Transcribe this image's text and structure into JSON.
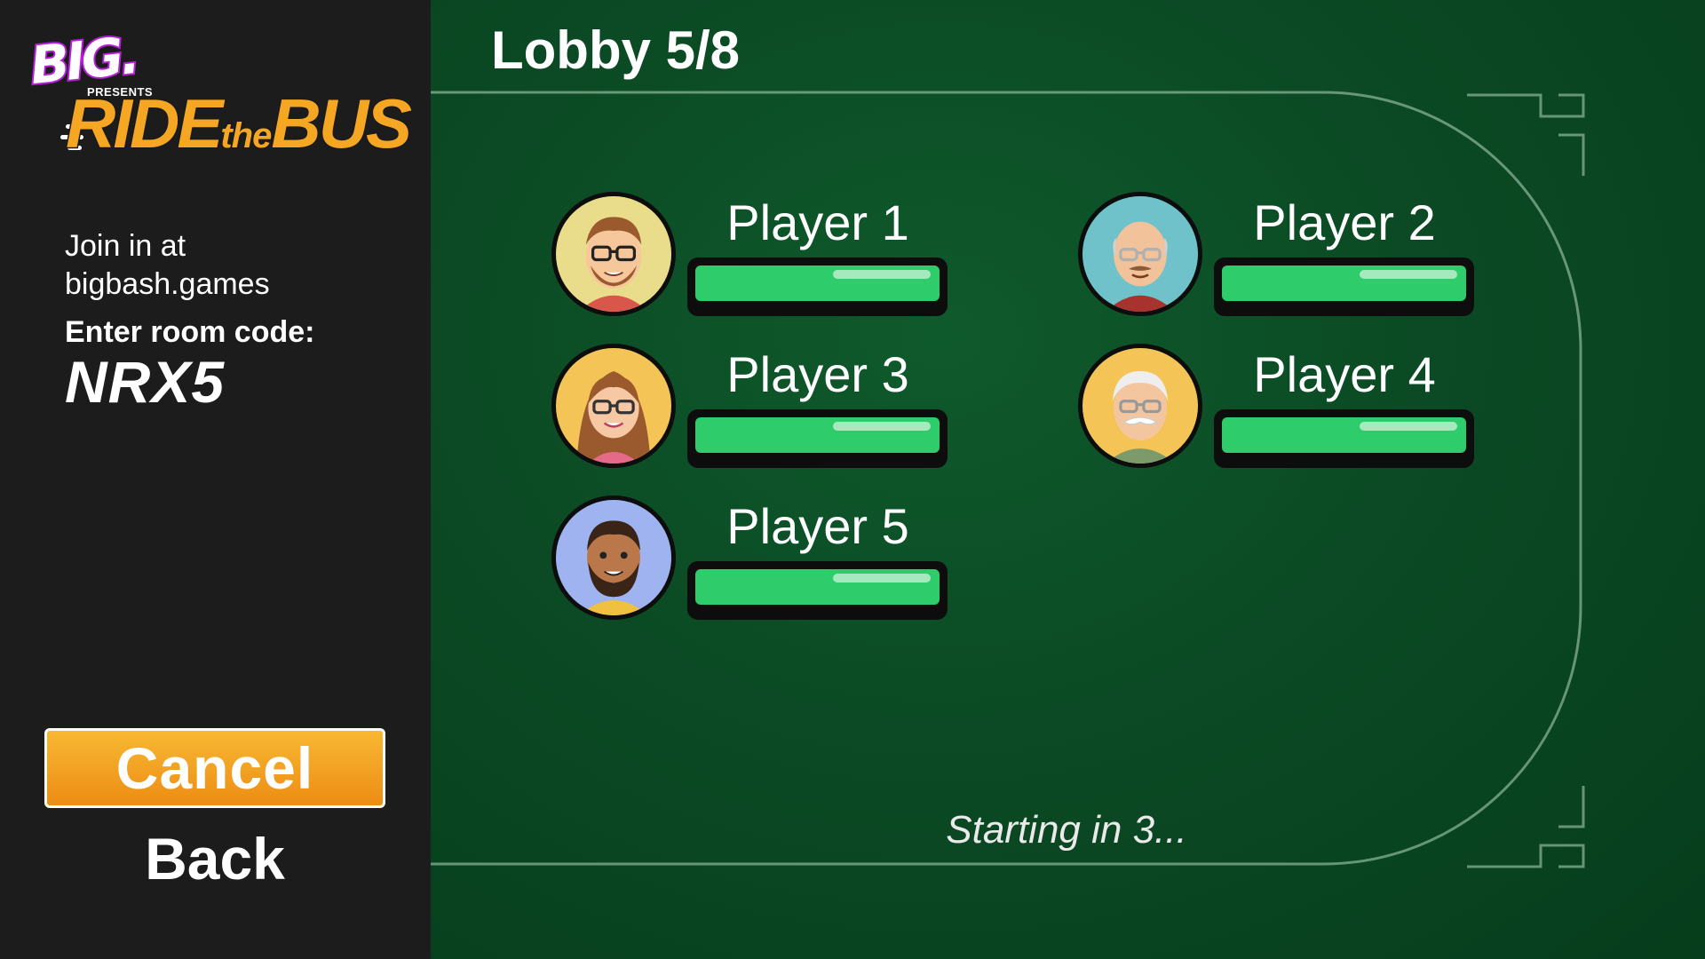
{
  "sidebar": {
    "logo": {
      "big": "BIG.",
      "presents": "PRESENTS",
      "title_ride": "RIDE",
      "title_the": "the",
      "title_bus": "BUS"
    },
    "join_line1": "Join in at",
    "join_line2": "bigbash.games",
    "room_code_label": "Enter room code:",
    "room_code": "NRX5",
    "cancel_label": "Cancel",
    "back_label": "Back"
  },
  "main": {
    "lobby_title": "Lobby 5/8",
    "players": [
      {
        "name": "Player 1",
        "avatar": "young-man-glasses-avatar"
      },
      {
        "name": "Player 2",
        "avatar": "bald-man-glasses-avatar"
      },
      {
        "name": "Player 3",
        "avatar": "woman-glasses-avatar"
      },
      {
        "name": "Player 4",
        "avatar": "old-man-mustache-avatar"
      },
      {
        "name": "Player 5",
        "avatar": "bearded-man-avatar"
      }
    ],
    "status": "Starting in 3..."
  },
  "colors": {
    "accent": "#f5a623",
    "bar": "#2ecc6a",
    "felt": "#0b4a24",
    "sidebar": "#1c1c1c"
  }
}
